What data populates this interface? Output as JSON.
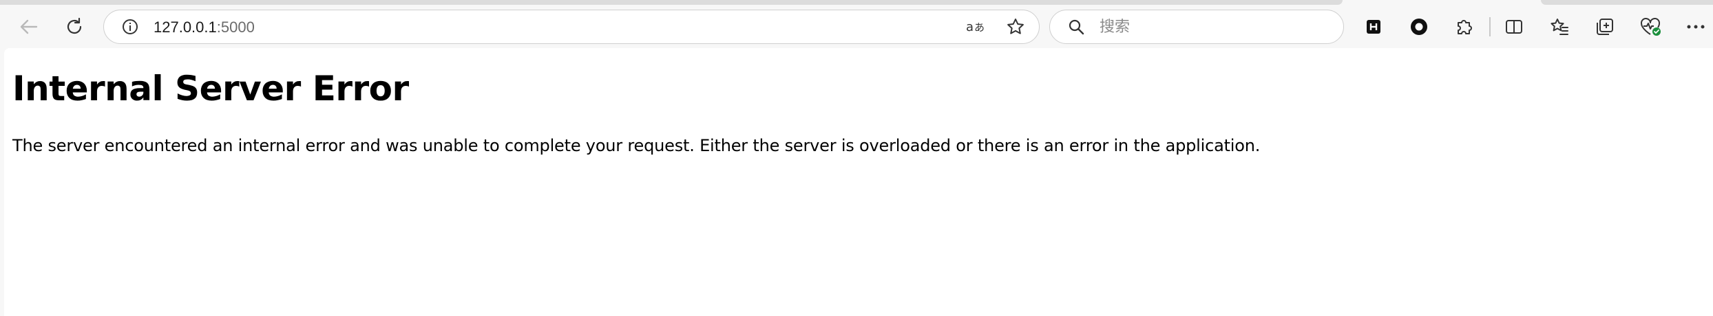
{
  "browser": {
    "address_bar": {
      "url_host": "127.0.0.1",
      "url_port": ":5000"
    },
    "search": {
      "placeholder": "搜索"
    },
    "icons": [
      "back-arrow-icon",
      "refresh-icon",
      "site-info-icon",
      "read-aloud-icon",
      "favorite-star-icon",
      "search-icon",
      "extension-h-icon",
      "extension-circle-icon",
      "extensions-puzzle-icon",
      "split-screen-icon",
      "favorites-icon",
      "collections-icon",
      "browser-essentials-icon",
      "more-menu-icon"
    ],
    "colors": {
      "toolbar_bg": "#f7f7f7",
      "page_bg": "#ffffff",
      "essentials_badge": "#1a8f3c"
    }
  },
  "page": {
    "title": "Internal Server Error",
    "message": "The server encountered an internal error and was unable to complete your request. Either the server is overloaded or there is an error in the application."
  }
}
